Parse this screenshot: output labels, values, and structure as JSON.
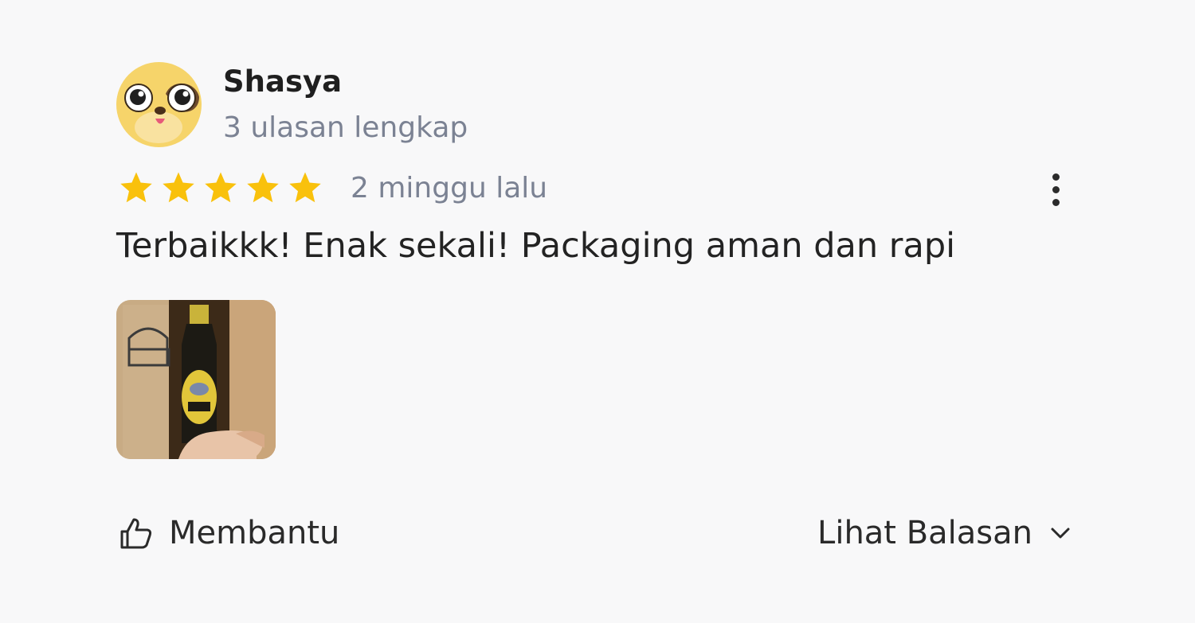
{
  "review": {
    "reviewer_name": "Shasya",
    "reviewer_meta": "3 ulasan lengkap",
    "rating": 5,
    "rating_max": 5,
    "time_ago": "2 minggu lalu",
    "text": "Terbaikkk! Enak sekali! Packaging aman dan rapi",
    "photo_icon": "product-photo-thumbnail",
    "more_icon": "kebab-menu-icon"
  },
  "actions": {
    "helpful_label": "Membantu",
    "helpful_icon": "thumbs-up-icon",
    "view_replies_label": "Lihat Balasan",
    "view_replies_icon": "chevron-down-icon"
  },
  "colors": {
    "star": "#f9c10c",
    "muted_text": "#7b8293",
    "primary_text": "#232323",
    "background": "#f8f8f9"
  }
}
